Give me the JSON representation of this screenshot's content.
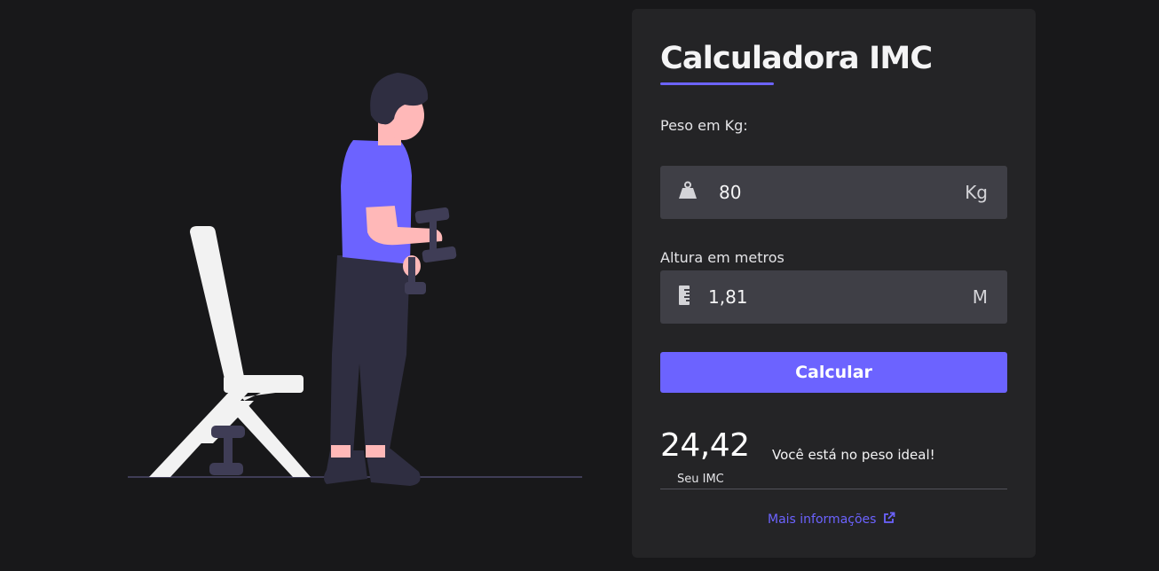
{
  "card": {
    "title": "Calculadora IMC",
    "weight": {
      "label": "Peso em Kg:",
      "value": "80",
      "unit": "Kg",
      "icon": "weight-icon"
    },
    "height": {
      "label": "Altura em metros",
      "value": "1,81",
      "unit": "M",
      "icon": "ruler-icon"
    },
    "button_label": "Calcular",
    "result": {
      "value": "24,42",
      "caption": "Seu IMC",
      "message": "Você está no peso ideal!"
    },
    "more_info": {
      "label": "Mais informações",
      "icon": "external-link-icon"
    }
  },
  "colors": {
    "accent": "#6c63ff",
    "background": "#18181a",
    "card": "#242426",
    "input": "#3f3f46"
  }
}
